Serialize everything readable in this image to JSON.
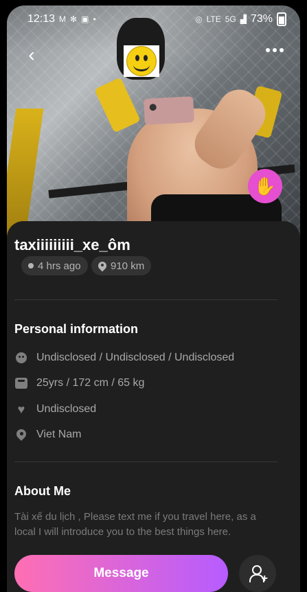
{
  "status_bar": {
    "time": "12:13",
    "battery": "73%",
    "network_label": "5G",
    "lte_label": "LTE"
  },
  "profile": {
    "username": "taxiiiiiiiii_xe_ôm",
    "last_seen": "4 hrs ago",
    "distance": "910 km"
  },
  "personal_info": {
    "title": "Personal information",
    "rows": [
      {
        "icon": "face-icon",
        "text": "Undisclosed / Undisclosed / Undisclosed"
      },
      {
        "icon": "scale-icon",
        "text": "25yrs / 172 cm / 65 kg"
      },
      {
        "icon": "heart-icon",
        "text": "Undisclosed"
      },
      {
        "icon": "location-icon",
        "text": "Viet Nam"
      }
    ]
  },
  "about_me": {
    "title": "About Me",
    "text": "Tài xế du lịch , Please text me if you travel here, as a local I will introduce you to the best things here."
  },
  "actions": {
    "message_label": "Message"
  },
  "colors": {
    "accent_gradient_start": "#ff6fb3",
    "accent_gradient_end": "#b65cff",
    "wave_button": "#e54fd0",
    "background": "#1f1f1f"
  }
}
